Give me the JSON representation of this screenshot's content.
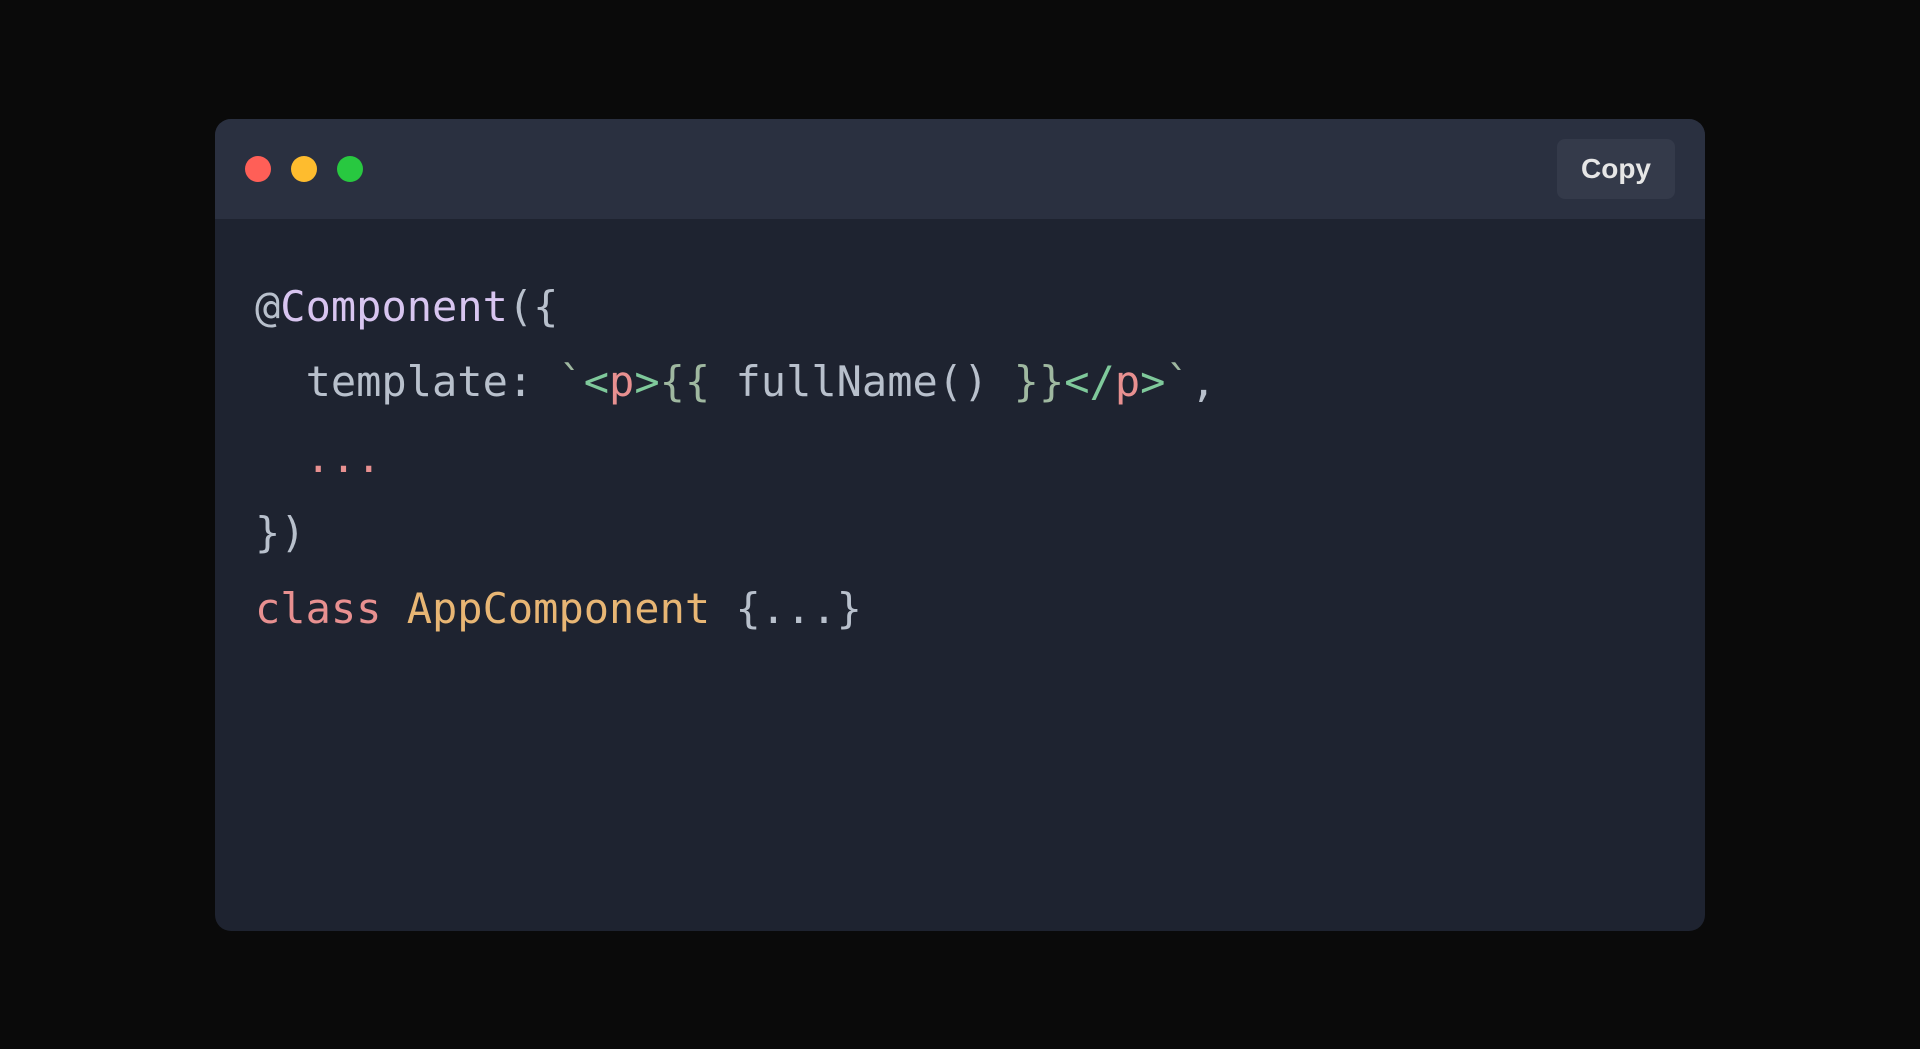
{
  "titlebar": {
    "copy_label": "Copy"
  },
  "code": {
    "line1": {
      "at": "@",
      "component": "Component",
      "open": "({"
    },
    "line2": {
      "indent": "  ",
      "key": "template",
      "colon": ": ",
      "backtick_open": "`",
      "tag_open_lt": "<",
      "tag_open_name": "p",
      "tag_open_gt": ">",
      "interp_open": "{{ ",
      "func_name": "fullName",
      "func_call": "()",
      "interp_close": " }}",
      "tag_close_lt": "</",
      "tag_close_name": "p",
      "tag_close_gt": ">",
      "backtick_close": "`",
      "comma": ","
    },
    "line3": {
      "indent": "  ",
      "spread": "..."
    },
    "line4": {
      "close": "})"
    },
    "line5": {
      "keyword": "class",
      "space": " ",
      "classname": "AppComponent",
      "space2": " ",
      "brace_open": "{",
      "spread": "...",
      "brace_close": "}"
    }
  }
}
